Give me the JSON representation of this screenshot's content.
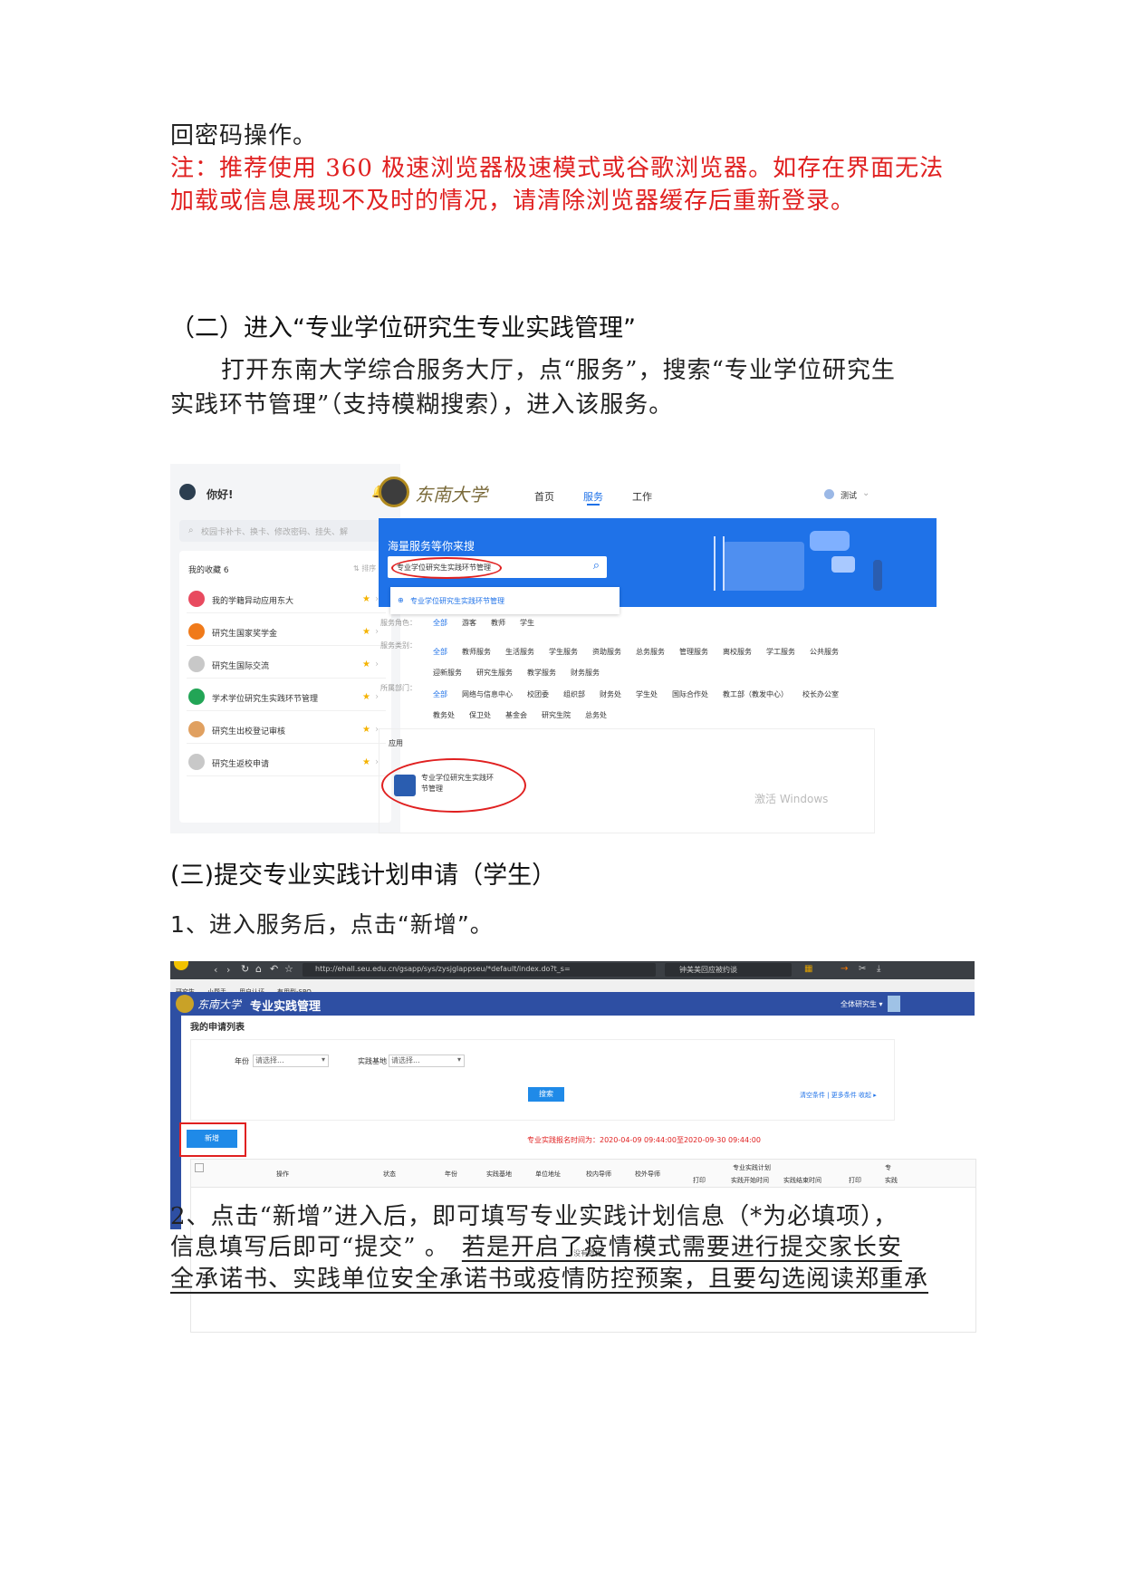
{
  "intro": {
    "line0": "回密码操作。",
    "note_line1": "注：推荐使用 360 极速浏览器极速模式或谷歌浏览器。如存在界面无法",
    "note_line2": "加载或信息展现不及时的情况，请清除浏览器缓存后重新登录。"
  },
  "section2": {
    "heading": "（二）进入“专业学位研究生专业实践管理”",
    "p_line1": "打开东南大学综合服务大厅，点“服务”，搜索“专业学位研究生",
    "p_line2": "实践环节管理”（支持模糊搜索），进入该服务。"
  },
  "screenshot1": {
    "left": {
      "greeting": "你好!",
      "search_placeholder": "校园卡补卡、换卡、修改密码、挂失、解",
      "favorites_title": "我的收藏 6",
      "sort_label": "⇅ 排序",
      "items": [
        {
          "label": "我的学籍异动应用东大",
          "color": "#e84a5f"
        },
        {
          "label": "研究生国家奖学金",
          "color": "#f07a1a"
        },
        {
          "label": "研究生国际交流",
          "color": "#c8c8c8"
        },
        {
          "label": "学术学位研究生实践环节管理",
          "color": "#22a556"
        },
        {
          "label": "研究生出校登记审核",
          "color": "#e0a060"
        },
        {
          "label": "研究生返校申请",
          "color": "#c8c8c8"
        }
      ]
    },
    "right": {
      "logo_text": "东南大学",
      "nav": [
        "首页",
        "服务",
        "工作"
      ],
      "user": "测试",
      "banner_title": "海量服务等你来搜",
      "search_value": "专业学位研究生实践环节管理",
      "suggestion": "专业学位研究生实践环节管理",
      "row_targets_label": "服务角色：",
      "row_targets": [
        "全部",
        "游客",
        "教师",
        "学生"
      ],
      "row_category_label": "服务类别：",
      "row_category": [
        "全部",
        "教师服务",
        "生活服务",
        "学生服务",
        "资助服务",
        "总务服务",
        "管理服务",
        "离校服务",
        "学工服务",
        "公共服务"
      ],
      "row_category2": [
        "迎新服务",
        "研究生服务",
        "教学服务",
        "财务服务"
      ],
      "row_dept_label": "所属部门：",
      "row_dept": [
        "全部",
        "网络与信息中心",
        "校团委",
        "组织部",
        "财务处",
        "学生处",
        "国际合作处",
        "教工部（教发中心）",
        "校长办公室"
      ],
      "row_dept2": [
        "教务处",
        "保卫处",
        "基金会",
        "研究生院",
        "总务处"
      ],
      "result_label": "应用",
      "result_app_line1": "专业学位研究生实践环",
      "result_app_line2": "节管理",
      "watermark": "激活 Windows"
    }
  },
  "section3": {
    "heading": "(三)提交专业实践计划申请（学生）",
    "step1": "1、进入服务后，点击“新增”。"
  },
  "screenshot2": {
    "url": "http://ehall.seu.edu.cn/gsapp/sys/zysjglappseu/*default/index.do?t_s=",
    "omnibox_right": "钟美美回应被约谈",
    "bookmarks": [
      "研究生",
      "小帮手",
      "用户认证",
      "有用型-SPO"
    ],
    "app_logo": "东南大学",
    "app_title": "专业实践管理",
    "role": "全体研究生 ▾",
    "list_title": "我的申请列表",
    "filter_year_label": "年份",
    "filter_year_value": "请选择...",
    "filter_base_label": "实践基地",
    "filter_base_value": "请选择...",
    "search_btn": "搜索",
    "filter_links": "清空条件 | 更多条件  收起 ▸",
    "add_btn": "新增",
    "period_notice": "专业实践报名时间为：2020-04-09 09:44:00至2020-09-30 09:44:00",
    "columns": [
      "操作",
      "状态",
      "年份",
      "实践基地",
      "单位地址",
      "校内导师",
      "校外导师"
    ],
    "group_header": "专业实践计划",
    "group_cols": [
      "打印",
      "实践开始时间",
      "实践结束时间"
    ],
    "extra_cols": [
      "打印",
      "实践"
    ],
    "extra_group": "专",
    "empty_text": "没有数据"
  },
  "step2": {
    "line1": "2、点击“新增”进入后，即可填写专业实践计划信息（*为必填项），",
    "line2a": "信息填写后即可“提交” 。",
    "line2b": "若是开启了疫情模式需要进行提交家长安",
    "line3": "全承诺书、实践单位安全承诺书或疫情防控预案，且要勾选阅读郑重承"
  }
}
